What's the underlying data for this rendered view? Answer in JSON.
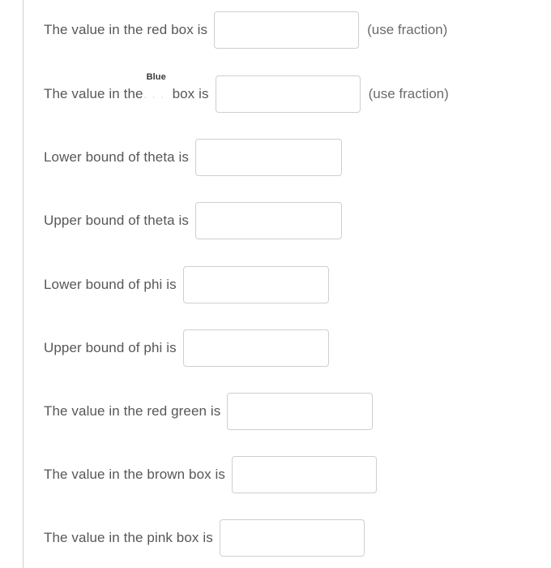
{
  "theme": {
    "page_background": "#ffffff",
    "label_color": "#575757",
    "hint_color": "#6b6b6b",
    "input_border_color": "#cfcfcf",
    "rule_color": "#d0d0d0",
    "token_label_color": "#3a3a3a"
  },
  "form": {
    "rows": [
      {
        "id": "red-box-value",
        "label": "The value in the red box is",
        "value": "",
        "placeholder": "",
        "hint": "(use fraction)"
      },
      {
        "id": "blue-box-value",
        "label_before": "The value in the",
        "token_label": "Blue",
        "token_ghost": "...",
        "label_after": "box is",
        "value": "",
        "placeholder": "",
        "hint": "(use fraction)"
      },
      {
        "id": "theta-lower-bound",
        "label": "Lower bound of theta is",
        "value": "",
        "placeholder": "",
        "hint": ""
      },
      {
        "id": "theta-upper-bound",
        "label": "Upper bound of theta is",
        "value": "",
        "placeholder": "",
        "hint": ""
      },
      {
        "id": "phi-lower-bound",
        "label": "Lower bound of phi is",
        "value": "",
        "placeholder": "",
        "hint": ""
      },
      {
        "id": "phi-upper-bound",
        "label": "Upper bound of phi is",
        "value": "",
        "placeholder": "",
        "hint": ""
      },
      {
        "id": "red-green-value",
        "label": "The value in the red green is",
        "value": "",
        "placeholder": "",
        "hint": ""
      },
      {
        "id": "brown-box-value",
        "label": "The value in the brown box is",
        "value": "",
        "placeholder": "",
        "hint": ""
      },
      {
        "id": "pink-box-value",
        "label": "The value in the pink box is",
        "value": "",
        "placeholder": "",
        "hint": ""
      }
    ]
  }
}
